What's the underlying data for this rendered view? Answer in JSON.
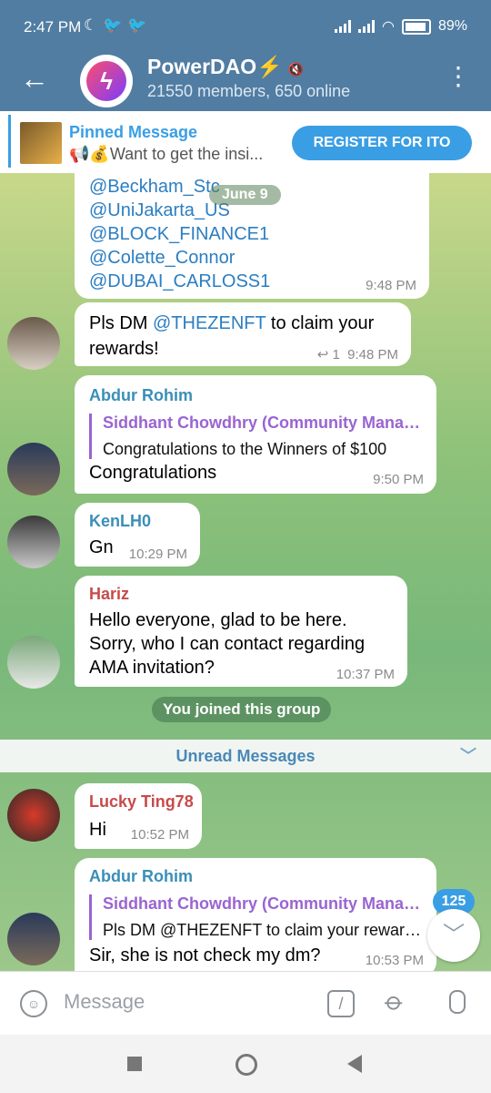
{
  "status_bar": {
    "time": "2:47 PM",
    "icons": [
      "moon-icon",
      "twitter-icon",
      "twitter-icon"
    ],
    "battery": "89%"
  },
  "header": {
    "group_name": "PowerDAO",
    "bolt": "⚡",
    "subtitle": "21550 members, 650 online"
  },
  "pinned": {
    "title": "Pinned Message",
    "text": "📢💰Want to get the insi...",
    "action": "REGISTER FOR ITO"
  },
  "chat": {
    "date_pill": "June 9",
    "msg1": {
      "lines": [
        "@Beckham_Stc",
        "@UniJakarta_US",
        "@BLOCK_FINANCE1",
        "@Colette_Connor",
        "@DUBAI_CARLOSS1"
      ],
      "time": "9:48 PM"
    },
    "msg2": {
      "text_prefix": "Pls DM ",
      "mention": "@THEZENFT",
      "text_suffix": " to claim your",
      "line2": "rewards!",
      "replies": "↩ 1",
      "time": "9:48 PM"
    },
    "msg3": {
      "sender": "Abdur Rohim",
      "quote_name": "Siddhant Chowdhry (Community Manager)",
      "quote_text": "Congratulations to the Winners of $100",
      "text": "Congratulations",
      "time": "9:50 PM"
    },
    "msg4": {
      "sender": "KenLH0",
      "text": "Gn",
      "time": "10:29 PM"
    },
    "msg5": {
      "sender": "Hariz",
      "lines": [
        "Hello everyone, glad to be here.",
        "Sorry, who I can contact regarding",
        "AMA invitation?"
      ],
      "time": "10:37 PM"
    },
    "service": "You joined this group",
    "unread": "Unread Messages",
    "msg6": {
      "sender": "Lucky Ting78",
      "text": "Hi",
      "time": "10:52 PM"
    },
    "msg7": {
      "sender": "Abdur Rohim",
      "quote_name": "Siddhant Chowdhry (Community Manager)",
      "quote_text": "Pls DM @THEZENFT to claim your rewards!",
      "text": "Sir, she is not check my dm?",
      "time": "10:53 PM"
    },
    "unread_badge": "125"
  },
  "input": {
    "placeholder": "Message"
  },
  "colors": {
    "header": "#517da2",
    "accent": "#3a9ee4",
    "quote": "#9a64d1",
    "sender_teal": "#3a8fb7",
    "sender_red": "#c84a4a"
  }
}
